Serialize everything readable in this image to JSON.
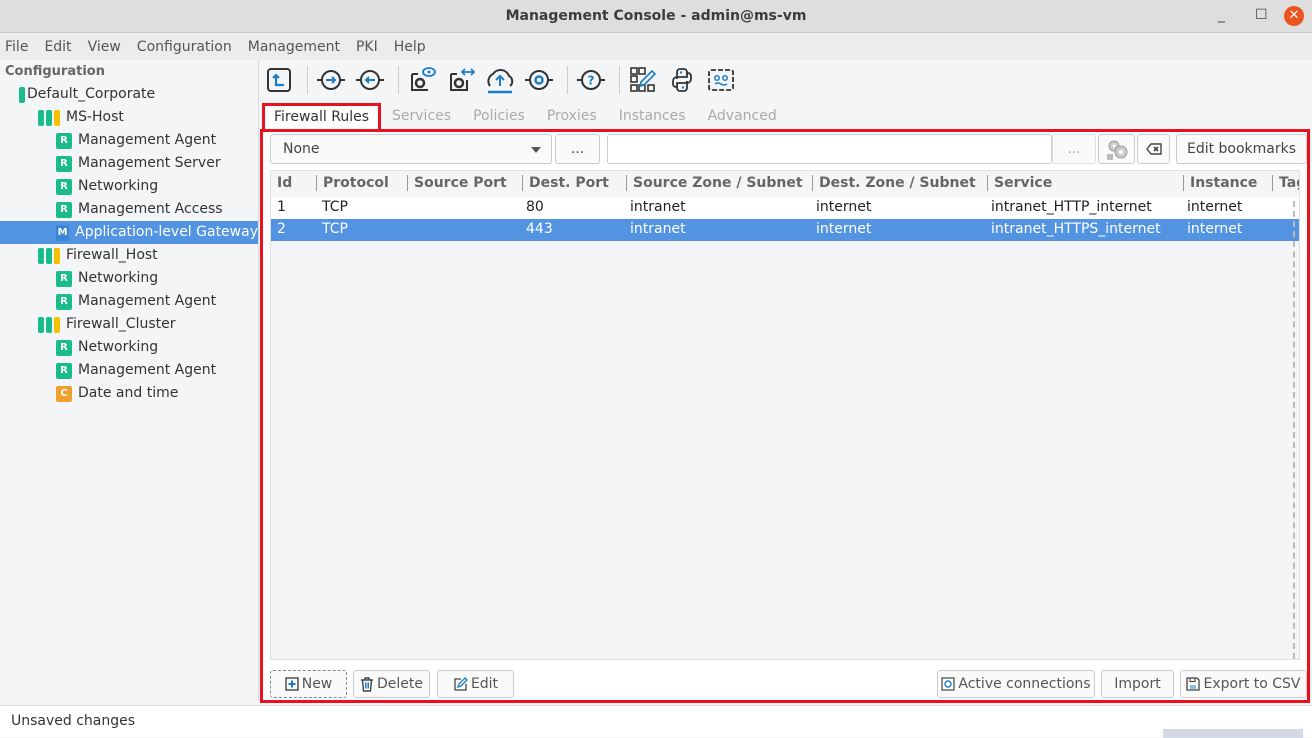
{
  "window": {
    "title": "Management Console - admin@ms-vm",
    "minimize": "_",
    "maximize": "☐",
    "close": "✕"
  },
  "menu": [
    "File",
    "Edit",
    "View",
    "Configuration",
    "Management",
    "PKI",
    "Help"
  ],
  "sidebar": {
    "title": "Configuration",
    "items": [
      {
        "label": "Default_Corporate",
        "type": "group",
        "bars": [
          "g"
        ]
      },
      {
        "label": "MS-Host",
        "type": "host",
        "bars": [
          "g",
          "g",
          "y"
        ]
      },
      {
        "label": "Management Agent",
        "badge": "R"
      },
      {
        "label": "Management Server",
        "badge": "R"
      },
      {
        "label": "Networking",
        "badge": "R"
      },
      {
        "label": "Management Access",
        "badge": "R"
      },
      {
        "label": "Application-level Gateway",
        "badge": "M",
        "selected": true
      },
      {
        "label": "Firewall_Host",
        "type": "host",
        "bars": [
          "g",
          "g",
          "y"
        ]
      },
      {
        "label": "Networking",
        "badge": "R"
      },
      {
        "label": "Management Agent",
        "badge": "R"
      },
      {
        "label": "Firewall_Cluster",
        "type": "host",
        "bars": [
          "g",
          "g",
          "y"
        ]
      },
      {
        "label": "Networking",
        "badge": "R"
      },
      {
        "label": "Management Agent",
        "badge": "R"
      },
      {
        "label": "Date and time",
        "badge": "C"
      }
    ]
  },
  "toolbar": [
    "upload-config-icon",
    "connect-in-icon",
    "connect-out-icon",
    "config-view-icon",
    "config-transfer-icon",
    "cloud-upload-icon",
    "service-gear-icon",
    "help-icon",
    "dashboard-edit-icon",
    "python-icon",
    "terminal-icon"
  ],
  "tabs": [
    {
      "label": "Firewall Rules",
      "active": true
    },
    {
      "label": "Services"
    },
    {
      "label": "Policies"
    },
    {
      "label": "Proxies"
    },
    {
      "label": "Instances"
    },
    {
      "label": "Advanced"
    }
  ],
  "filter": {
    "bookmark_value": "None",
    "more_label": "...",
    "search_value": "",
    "search_more": "...",
    "edit_bookmarks": "Edit bookmarks"
  },
  "table": {
    "columns": [
      "Id",
      "Protocol",
      "Source Port",
      "Dest. Port",
      "Source Zone / Subnet",
      "Dest. Zone / Subnet",
      "Service",
      "Instance",
      "Tag"
    ],
    "rows": [
      [
        "1",
        "TCP",
        "",
        "80",
        "intranet",
        "internet",
        "intranet_HTTP_internet",
        "internet",
        ""
      ],
      [
        "2",
        "TCP",
        "",
        "443",
        "intranet",
        "internet",
        "intranet_HTTPS_internet",
        "internet",
        ""
      ]
    ],
    "selected_row": 1
  },
  "footer": {
    "new": "New",
    "delete": "Delete",
    "edit": "Edit",
    "active_connections": "Active connections",
    "import": "Import",
    "export": "Export to CSV"
  },
  "status": {
    "text": "Unsaved changes"
  }
}
